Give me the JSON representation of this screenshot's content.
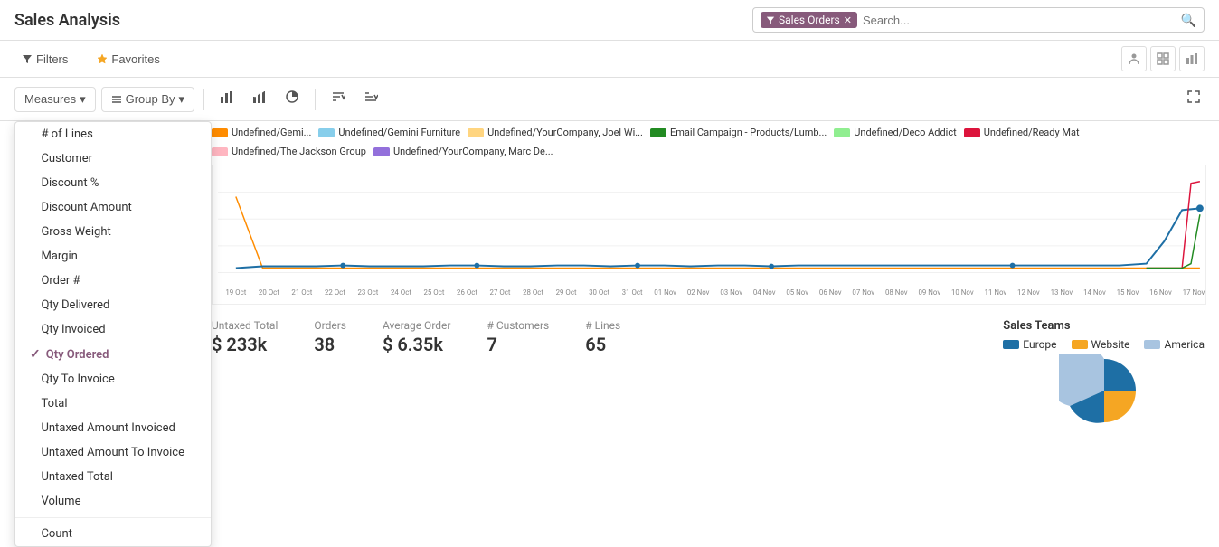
{
  "header": {
    "title": "Sales Analysis",
    "search": {
      "filter_tag": "Sales Orders",
      "placeholder": "Search..."
    },
    "filter_btn": "Filters",
    "favorites_btn": "Favorites"
  },
  "controls": {
    "measures_label": "Measures",
    "groupby_label": "Group By"
  },
  "measures_dropdown": {
    "items": [
      {
        "id": "lines",
        "label": "# of Lines",
        "active": false
      },
      {
        "id": "customer",
        "label": "Customer",
        "active": false
      },
      {
        "id": "discount_pct",
        "label": "Discount %",
        "active": false
      },
      {
        "id": "discount_amt",
        "label": "Discount Amount",
        "active": false
      },
      {
        "id": "gross_weight",
        "label": "Gross Weight",
        "active": false
      },
      {
        "id": "margin",
        "label": "Margin",
        "active": false
      },
      {
        "id": "order_num",
        "label": "Order #",
        "active": false
      },
      {
        "id": "qty_delivered",
        "label": "Qty Delivered",
        "active": false
      },
      {
        "id": "qty_invoiced",
        "label": "Qty Invoiced",
        "active": false
      },
      {
        "id": "qty_ordered",
        "label": "Qty Ordered",
        "active": true
      },
      {
        "id": "qty_to_invoice",
        "label": "Qty To Invoice",
        "active": false
      },
      {
        "id": "total",
        "label": "Total",
        "active": false
      },
      {
        "id": "untaxed_invoiced",
        "label": "Untaxed Amount Invoiced",
        "active": false
      },
      {
        "id": "untaxed_to_invoice",
        "label": "Untaxed Amount To Invoice",
        "active": false
      },
      {
        "id": "untaxed_total",
        "label": "Untaxed Total",
        "active": false
      },
      {
        "id": "volume",
        "label": "Volume",
        "active": false
      }
    ],
    "divider_label": "Count",
    "count_label": "Count"
  },
  "chart": {
    "legend": [
      {
        "label": "Undefined/Gemini Furniture",
        "color": "#87CEEB"
      },
      {
        "label": "Undefined/YourCompany, Joel Wi...",
        "color": "#FFD580"
      },
      {
        "label": "Email Campaign - Products/Lumb...",
        "color": "#228B22"
      },
      {
        "label": "Undefined/Deco Addict",
        "color": "#90EE90"
      },
      {
        "label": "Undefined/Ready Mat",
        "color": "#DC143C"
      },
      {
        "label": "Undefined/The Jackson Group",
        "color": "#FFB6C1"
      },
      {
        "label": "Undefined/YourCompany, Marc De...",
        "color": "#9370DB"
      },
      {
        "label": "Undefined/Gemi...",
        "color": "#FF8C00"
      }
    ],
    "x_labels": [
      "19 Oct 2020",
      "20 Oct 2020",
      "21 Oct 2020",
      "22 Oct 2020",
      "23 Oct 2020",
      "24 Oct 2020",
      "25 Oct 2020",
      "26 Oct 2020",
      "27 Oct 2020",
      "28 Oct 2020",
      "29 Oct 2020",
      "30 Oct 2020",
      "31 Oct 2020",
      "01 Nov 2020",
      "02 Nov 2020",
      "03 Nov 2020",
      "04 Nov 2020",
      "05 Nov 2020",
      "06 Nov 2020",
      "07 Nov 2020",
      "08 Nov 2020",
      "09 Nov 2020",
      "10 Nov 2020",
      "11 Nov 2020",
      "12 Nov 2020",
      "13 Nov 2020",
      "14 Nov 2020",
      "15 Nov 2020",
      "16 Nov 2020",
      "17 Nov 2020"
    ]
  },
  "stats": [
    {
      "id": "untaxed_total",
      "label": "Untaxed Total",
      "value": "$ 233k"
    },
    {
      "id": "orders",
      "label": "Orders",
      "value": "38"
    },
    {
      "id": "avg_order",
      "label": "Average Order",
      "value": "$ 6.35k"
    },
    {
      "id": "customers",
      "label": "# Customers",
      "value": "7"
    },
    {
      "id": "lines",
      "label": "# Lines",
      "value": "65"
    }
  ],
  "sales_teams": {
    "title": "Sales Teams",
    "legend": [
      {
        "label": "Europe",
        "color": "#1e6fa5"
      },
      {
        "label": "Website",
        "color": "#f5a623"
      },
      {
        "label": "America",
        "color": "#a8c4e0"
      }
    ]
  }
}
